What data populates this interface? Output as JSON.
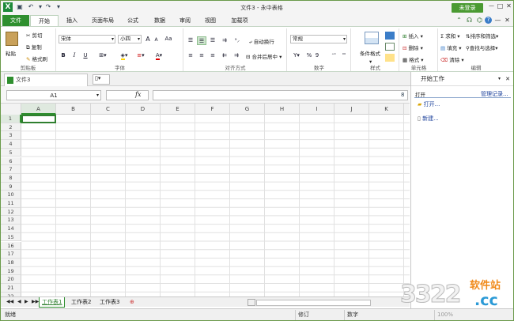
{
  "app": {
    "logo": "X",
    "title": "文件3 - 永中表格",
    "login": "未登录",
    "help": "?"
  },
  "tabs": [
    {
      "label": "文件"
    },
    {
      "label": "开始"
    },
    {
      "label": "插入"
    },
    {
      "label": "页面布局"
    },
    {
      "label": "公式"
    },
    {
      "label": "数据"
    },
    {
      "label": "审阅"
    },
    {
      "label": "视图"
    },
    {
      "label": "加载项"
    }
  ],
  "ribbon": {
    "clipboard": {
      "label": "剪贴板",
      "paste": "粘贴",
      "cut": "剪切",
      "copy": "复制",
      "format_painter": "格式刷"
    },
    "font": {
      "label": "字体",
      "name": "宋体",
      "size": "小四",
      "bold": "B",
      "italic": "I",
      "underline": "U",
      "grow": "A",
      "shrink": "A",
      "case": "Aa"
    },
    "alignment": {
      "label": "对齐方式",
      "wrap": "自动换行",
      "merge": "合并后居中"
    },
    "number": {
      "label": "数字",
      "format": "常规",
      "percent": "%",
      "comma": "9"
    },
    "styles": {
      "label": "样式",
      "conditional": "条件格式"
    },
    "cells": {
      "label": "单元格",
      "insert": "插入",
      "delete": "删除",
      "format": "格式"
    },
    "editing": {
      "label": "编辑",
      "sum": "求和",
      "fill": "填充",
      "clear": "清除",
      "sort": "排序和筛选",
      "find": "查找与选择"
    }
  },
  "document": {
    "tab": "文件3"
  },
  "formula_bar": {
    "name_box": "A1",
    "fx": "fx",
    "value": ""
  },
  "columns": [
    "A",
    "B",
    "C",
    "D",
    "E",
    "F",
    "G",
    "H",
    "I",
    "J",
    "K"
  ],
  "rows": [
    "1",
    "2",
    "3",
    "4",
    "5",
    "6",
    "7",
    "8",
    "9",
    "10",
    "11",
    "12",
    "13",
    "14",
    "15",
    "16",
    "17",
    "18",
    "19",
    "20",
    "21",
    "22"
  ],
  "sheets": [
    {
      "name": "工作表1",
      "active": true
    },
    {
      "name": "工作表2",
      "active": false
    },
    {
      "name": "工作表3",
      "active": false
    }
  ],
  "status": {
    "ready": "就绪",
    "revise": "修订",
    "num": "数字",
    "zoom": "100%"
  },
  "task_pane": {
    "title": "开始工作",
    "open_section": "打开",
    "manage": "管理记录...",
    "open": "打开...",
    "new": "新建..."
  },
  "watermark": {
    "digits": "3322",
    "cn": "软件站",
    "cc": ".cc"
  },
  "colors": {
    "accent": "#2f8f2f",
    "link": "#1a3f9a"
  }
}
